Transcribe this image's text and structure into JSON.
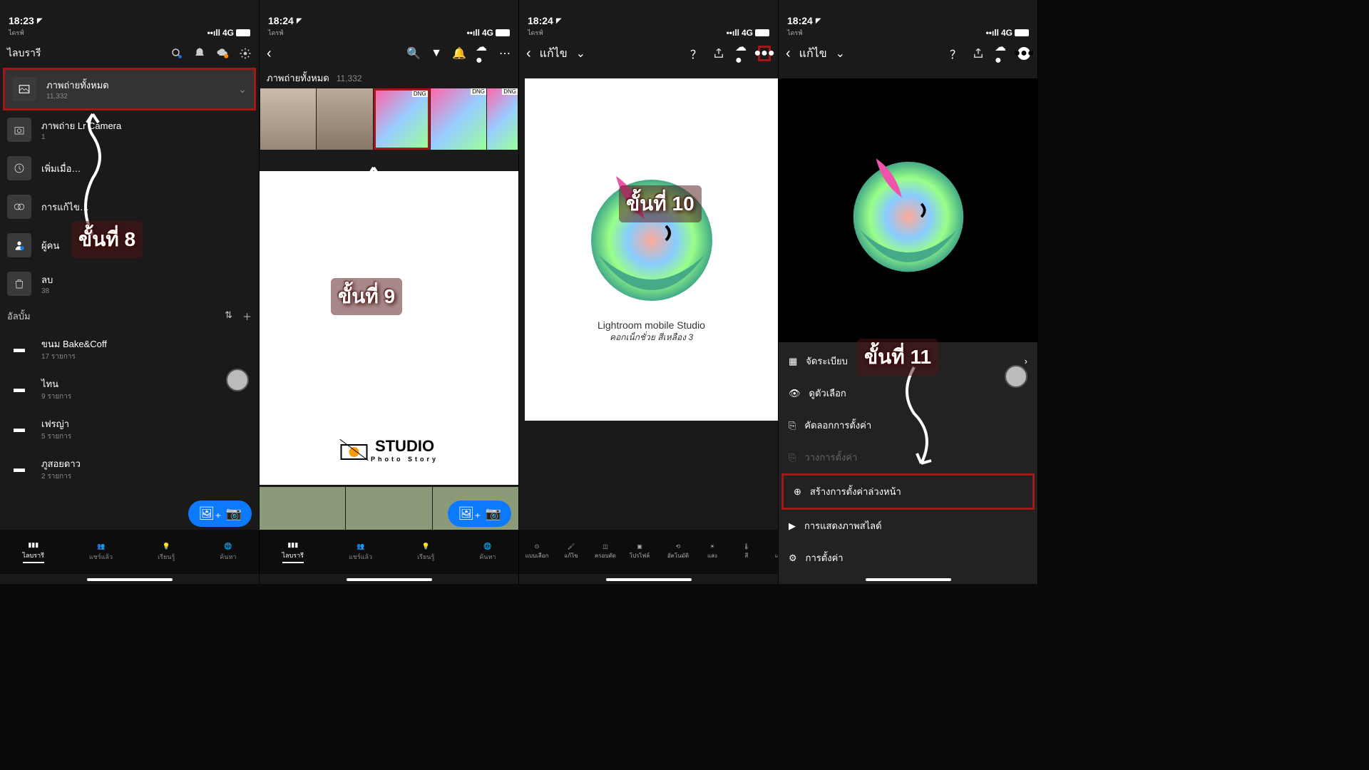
{
  "s1": {
    "time": "18:23",
    "carrier": "ไดรฟ์",
    "net": "4G",
    "title": "ไลบรารี",
    "items": [
      {
        "label": "ภาพถ่ายทั้งหมด",
        "count": "11,332"
      },
      {
        "label": "ภาพถ่าย Lr Camera",
        "count": "1"
      },
      {
        "label": "เพิ่มเมื่อ…",
        "count": ""
      },
      {
        "label": "การแก้ไข…",
        "count": ""
      },
      {
        "label": "ผู้คน",
        "count": ""
      },
      {
        "label": "ลบ",
        "count": "38"
      }
    ],
    "album_title": "อัลบั้ม",
    "albums": [
      {
        "label": "ขนม Bake&Coff",
        "count": "17 รายการ"
      },
      {
        "label": "ไทน",
        "count": "9 รายการ"
      },
      {
        "label": "เฟรญ่า",
        "count": "5 รายการ"
      },
      {
        "label": "ภูสอยดาว",
        "count": "2 รายการ"
      }
    ],
    "nav": [
      "ไลบรารี",
      "แชร์แล้ว",
      "เรียนรู้",
      "ค้นหา"
    ],
    "step": "ขั้นที่ 8"
  },
  "s2": {
    "time": "18:24",
    "carrier": "ไดรฟ์",
    "net": "4G",
    "gallery_title": "ภาพถ่ายทั้งหมด",
    "gallery_count": "11,332",
    "dng": "DNG",
    "studio": "STUDIO",
    "studio_sub": "Photo Story",
    "nav": [
      "ไลบรารี",
      "แชร์แล้ว",
      "เรียนรู้",
      "ค้นหา"
    ],
    "step": "ขั้นที่ 9"
  },
  "s3": {
    "time": "18:24",
    "carrier": "ไดรฟ์",
    "net": "4G",
    "edit": "แก้ไข",
    "whale_title": "Lightroom mobile Studio",
    "whale_sub": "คอกเน็กชั่วย สีเหลือง 3",
    "tools": [
      "แบบเลือก",
      "แก้ไข",
      "ครอบตัด",
      "โปรไฟล์",
      "อัตโนมัติ",
      "แสง",
      "สี",
      "เอฟเ"
    ],
    "step": "ขั้นที่ 10"
  },
  "s4": {
    "time": "18:24",
    "carrier": "ไดรฟ์",
    "net": "4G",
    "edit": "แก้ไข",
    "menu": [
      {
        "label": "จัดระเบียบ",
        "chev": true
      },
      {
        "label": "ดูตัวเลือก"
      },
      {
        "label": "คัดลอกการตั้งค่า"
      },
      {
        "label": "วางการตั้งค่า",
        "disabled": true
      },
      {
        "label": "สร้างการตั้งค่าล่วงหน้า",
        "highlight": true
      },
      {
        "label": "การแสดงภาพสไลด์"
      },
      {
        "label": "การตั้งค่า"
      }
    ],
    "step": "ขั้นที่ 11"
  }
}
